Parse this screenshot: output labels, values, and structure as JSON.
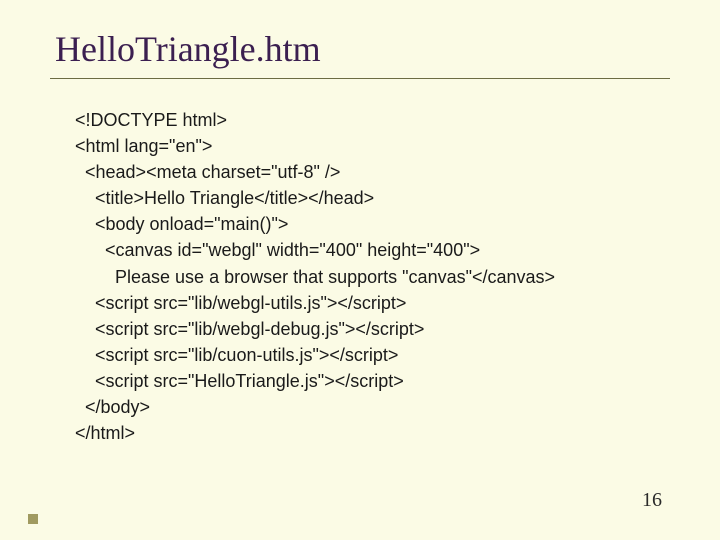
{
  "title": "HelloTriangle.htm",
  "code": "<!DOCTYPE html>\n<html lang=\"en\">\n  <head><meta charset=\"utf-8\" />\n    <title>Hello Triangle</title></head>\n    <body onload=\"main()\">\n      <canvas id=\"webgl\" width=\"400\" height=\"400\">\n        Please use a browser that supports \"canvas\"</canvas>\n    <script src=\"lib/webgl-utils.js\"></script>\n    <script src=\"lib/webgl-debug.js\"></script>\n    <script src=\"lib/cuon-utils.js\"></script>\n    <script src=\"HelloTriangle.js\"></script>\n  </body>\n</html>",
  "pageNumber": "16"
}
